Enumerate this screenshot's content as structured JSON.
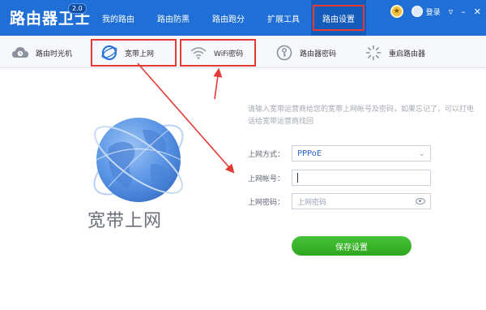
{
  "app": {
    "title": "路由器卫士",
    "version": "2.0"
  },
  "topnav": {
    "items": [
      {
        "label": "我的路由"
      },
      {
        "label": "路由防黑"
      },
      {
        "label": "路由跑分"
      },
      {
        "label": "扩展工具"
      },
      {
        "label": "路由设置",
        "active": true
      }
    ]
  },
  "user": {
    "login_label": "登录"
  },
  "subnav": {
    "items": [
      {
        "label": "路由时光机",
        "icon": "cloud-clock-icon"
      },
      {
        "label": "宽带上网",
        "icon": "globe-icon",
        "highlighted": true
      },
      {
        "label": "WiFi密码",
        "icon": "wifi-icon",
        "highlighted": true
      },
      {
        "label": "路由器密码",
        "icon": "key-icon"
      },
      {
        "label": "重启路由器",
        "icon": "restart-icon"
      }
    ]
  },
  "content": {
    "caption": "宽带上网",
    "hint": "请输入宽带运营商给您的宽带上网帐号及密码，如果忘记了，可以打电话给宽带运营商找回",
    "form": {
      "mode_label": "上网方式：",
      "mode_value": "PPPoE",
      "account_label": "上网帐号：",
      "account_value": "",
      "password_label": "上网密码：",
      "password_placeholder": "上网密码"
    },
    "save_label": "保存设置"
  },
  "colors": {
    "topbar": "#1f6fd6",
    "highlight": "#e53935",
    "accent_green": "#37b22a",
    "link_blue": "#2a66c9"
  }
}
